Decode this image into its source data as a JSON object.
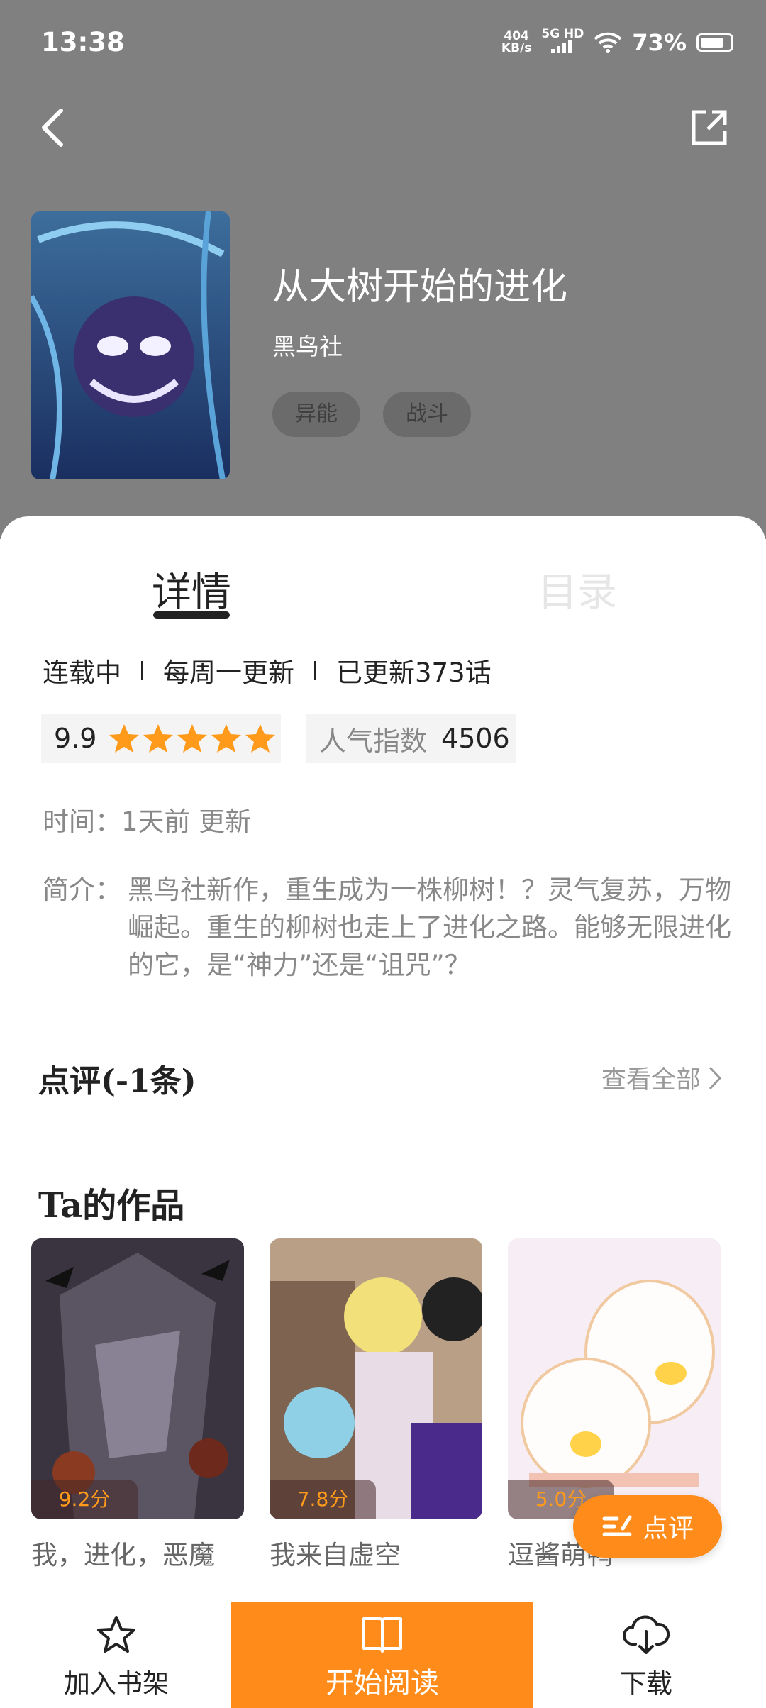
{
  "status_bar": {
    "time": "13:38",
    "net_speed_top": "404",
    "net_speed_unit": "KB/s",
    "network": "5G HD",
    "battery": "73%"
  },
  "comic": {
    "title": "从大树开始的进化",
    "author": "黑鸟社",
    "tags": [
      "异能",
      "战斗"
    ]
  },
  "tabs": {
    "detail": "详情",
    "catalog": "目录"
  },
  "meta": {
    "status": "连载中",
    "schedule": "每周一更新",
    "progress": "已更新373话"
  },
  "rating": {
    "score": "9.9",
    "stars": 5,
    "popularity_label": "人气指数",
    "popularity_value": "4506"
  },
  "update_time": "时间：1天前 更新",
  "intro": {
    "label": "简介：",
    "text": "黑鸟社新作，重生成为一株柳树！？灵气复苏，万物崛起。重生的柳树也走上了进化之路。能够无限进化的它，是“神力”还是“诅咒”？"
  },
  "reviews": {
    "title": "点评(-1条)",
    "see_all": "查看全部"
  },
  "works": {
    "title": "Ta的作品",
    "items": [
      {
        "title": "我，进化，恶魔",
        "score": "9.2分"
      },
      {
        "title": "我来自虚空",
        "score": "7.8分"
      },
      {
        "title": "逗酱萌鸭",
        "score": "5.0分"
      }
    ]
  },
  "fab": {
    "label": "点评"
  },
  "bottom_bar": {
    "bookshelf": "加入书架",
    "read": "开始阅读",
    "download": "下载"
  },
  "colors": {
    "accent": "#ff8c1a",
    "header_bg": "#808080",
    "star": "#ff9a1a"
  }
}
